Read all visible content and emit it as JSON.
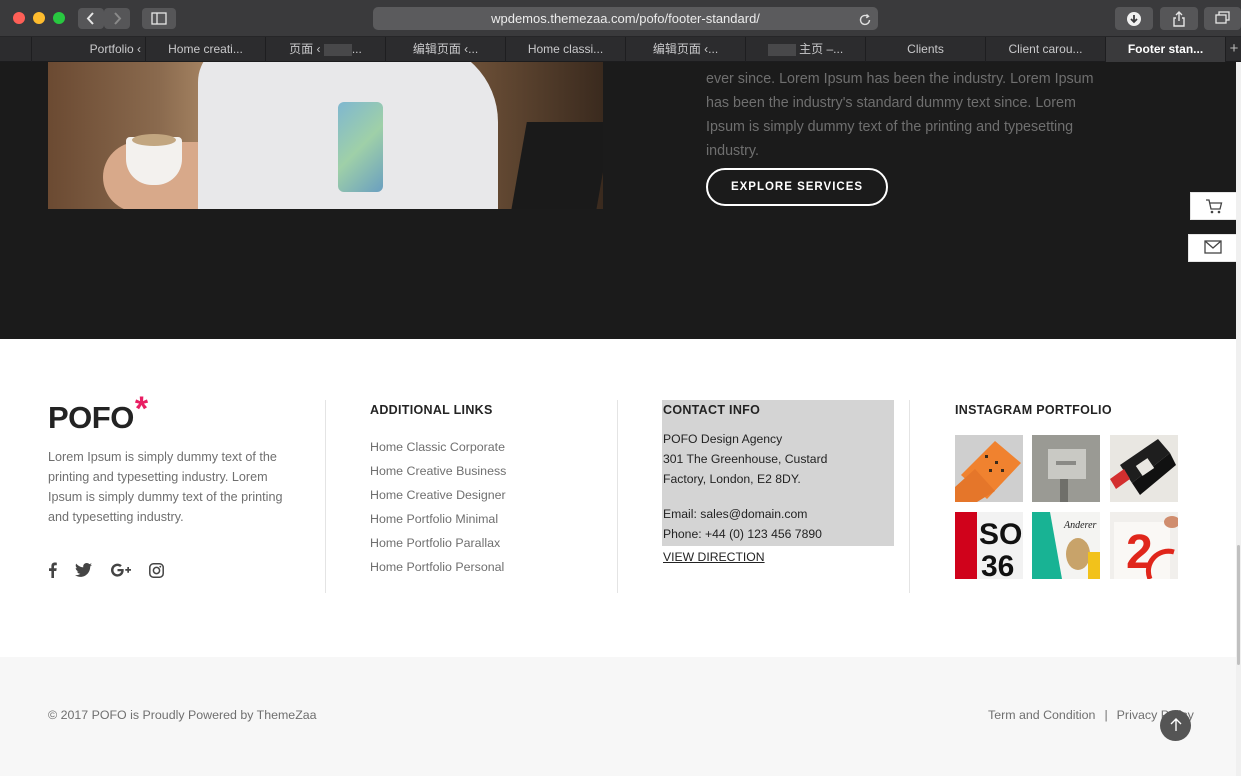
{
  "browser": {
    "url": "wpdemos.themezaa.com/pofo/footer-standard/",
    "tabs": [
      {
        "label": ""
      },
      {
        "label": "Portfolio ‹"
      },
      {
        "label": "Home creati..."
      },
      {
        "label": "页面 ‹"
      },
      {
        "label": "编辑页面 ‹..."
      },
      {
        "label": "Home classi..."
      },
      {
        "label": "编辑页面 ‹..."
      },
      {
        "label": "主页 –..."
      },
      {
        "label": "Clients"
      },
      {
        "label": "Client carou..."
      },
      {
        "label": "Footer stan..."
      }
    ],
    "tab_dots": "..."
  },
  "hero": {
    "body_text": "ever since. Lorem Ipsum has been the industry. Lorem Ipsum has been the industry's standard dummy text since. Lorem Ipsum is simply dummy text of the printing and typesetting industry.",
    "button_label": "EXPLORE SERVICES"
  },
  "footer": {
    "logo_text": "POFO",
    "logo_mark": "*",
    "about_text": "Lorem Ipsum is simply dummy text of the printing and typesetting industry. Lorem Ipsum is simply dummy text of the printing and typesetting industry.",
    "social": [
      "facebook-icon",
      "twitter-icon",
      "google-plus-icon",
      "instagram-icon"
    ],
    "links_heading": "ADDITIONAL LINKS",
    "links": [
      "Home Classic Corporate",
      "Home Creative Business",
      "Home Creative Designer",
      "Home Portfolio Minimal",
      "Home Portfolio Parallax",
      "Home Portfolio Personal"
    ],
    "contact_heading": "CONTACT INFO",
    "contact_company": "POFO Design Agency",
    "contact_address_1": "301 The Greenhouse, Custard",
    "contact_address_2": "Factory, London, E2 8DY.",
    "contact_email": "Email: sales@domain.com",
    "contact_phone": "Phone: +44 (0) 123 456 7890",
    "contact_link": "VIEW DIRECTION",
    "instagram_heading": "INSTAGRAM PORTFOLIO"
  },
  "bottom": {
    "copyright": "© 2017 POFO is Proudly Powered by ThemeZaa",
    "terms": "Term and Condition",
    "separator": "|",
    "privacy": "Privacy Policy"
  },
  "colors": {
    "accent": "#e91e63",
    "dark_bg": "#1b1b1b",
    "footer_bg": "#ffffff",
    "bottom_bg": "#f7f7f7"
  }
}
